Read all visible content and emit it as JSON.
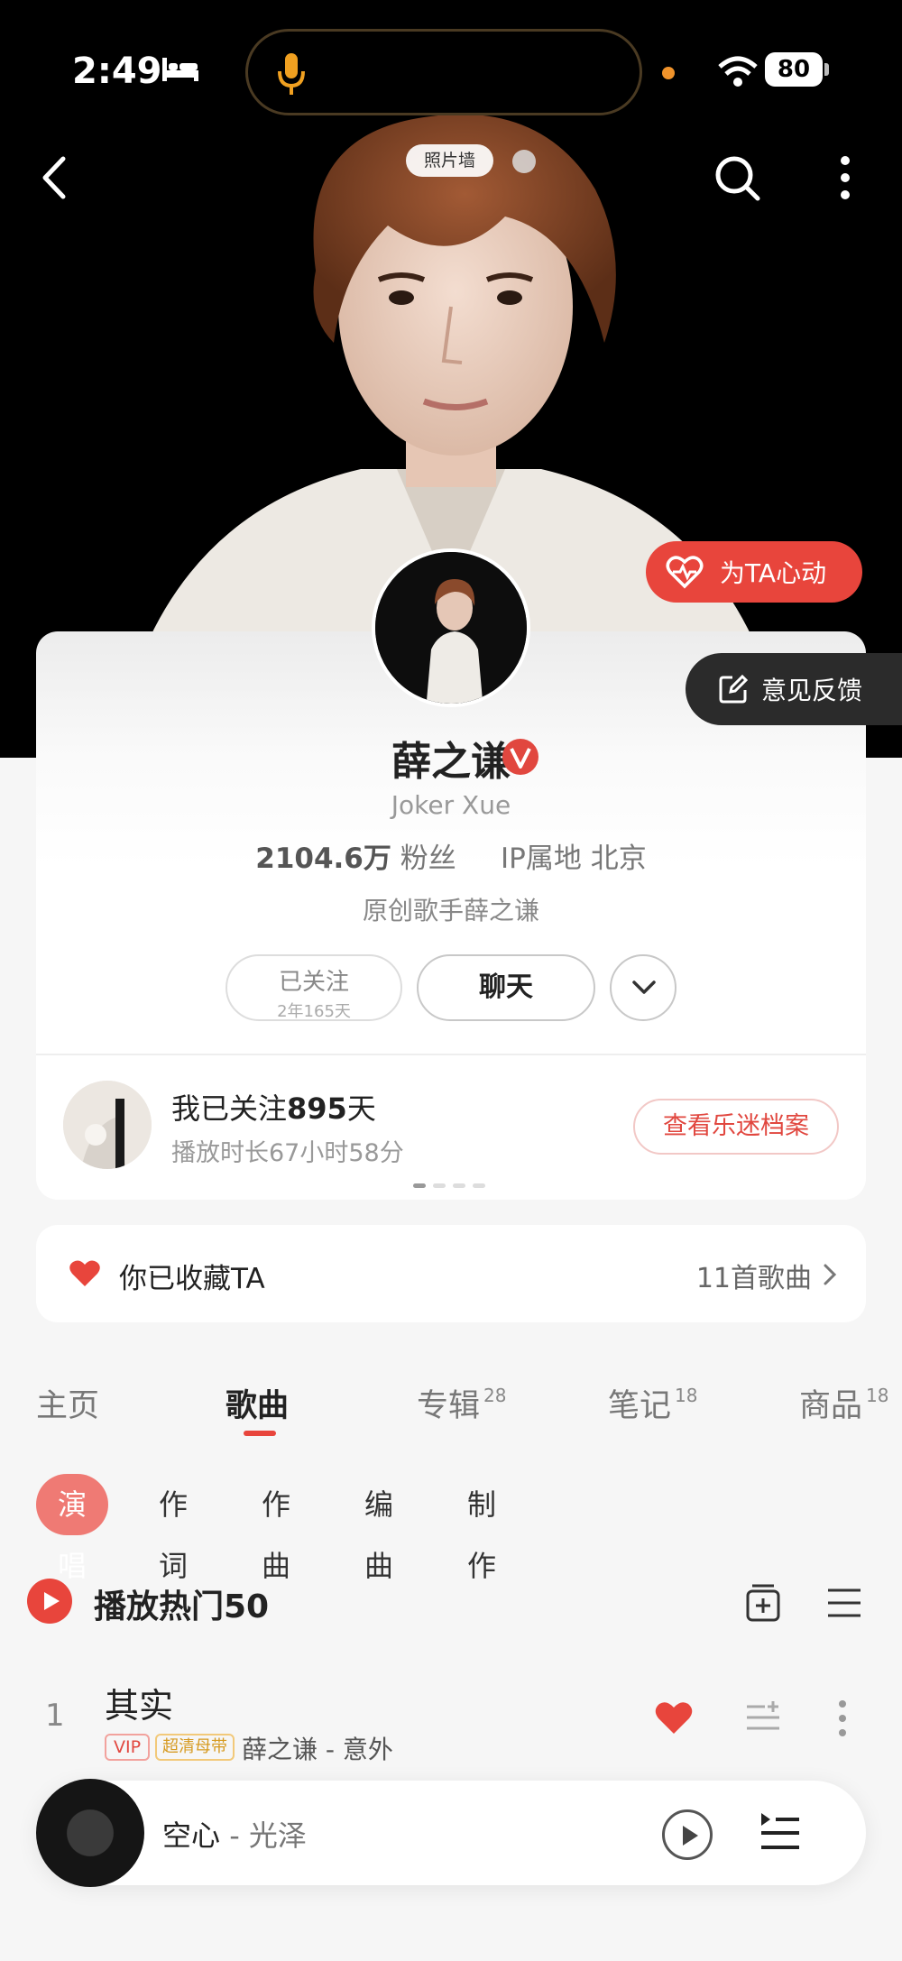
{
  "status": {
    "time": "2:49",
    "battery": "80"
  },
  "hero": {
    "photo_wall": "照片墙",
    "heart_button": "为TA心动"
  },
  "feedback": {
    "label": "意见反馈"
  },
  "profile": {
    "name": "薛之谦",
    "name_en": "Joker Xue",
    "fans_count": "2104.6万",
    "fans_label": "粉丝",
    "ip_location": "IP属地 北京",
    "bio": "原创歌手薛之谦",
    "followed_label": "已关注",
    "followed_duration": "2年165天",
    "chat_label": "聊天"
  },
  "fan": {
    "days_prefix": "我已关注",
    "days_value": "895",
    "days_suffix": "天",
    "playtime": "播放时长67小时58分",
    "archive_button": "查看乐迷档案"
  },
  "collection": {
    "label": "你已收藏TA",
    "count": "11首歌曲"
  },
  "tabs": [
    {
      "label": "主页",
      "count": ""
    },
    {
      "label": "歌曲",
      "count": ""
    },
    {
      "label": "专辑",
      "count": "28"
    },
    {
      "label": "笔记",
      "count": "18"
    },
    {
      "label": "商品",
      "count": "18"
    }
  ],
  "subtabs": [
    "演唱",
    "作词",
    "作曲",
    "编曲",
    "制作"
  ],
  "hot": {
    "label": "播放热门50"
  },
  "songs": [
    {
      "index": "1",
      "title": "其实",
      "tag_vip": "VIP",
      "tag_quality": "超清母带",
      "meta": "薛之谦 - 意外"
    }
  ],
  "player": {
    "song": "空心",
    "artist": "- 光泽"
  },
  "colors": {
    "accent": "#e8453c",
    "dark": "#000000"
  }
}
